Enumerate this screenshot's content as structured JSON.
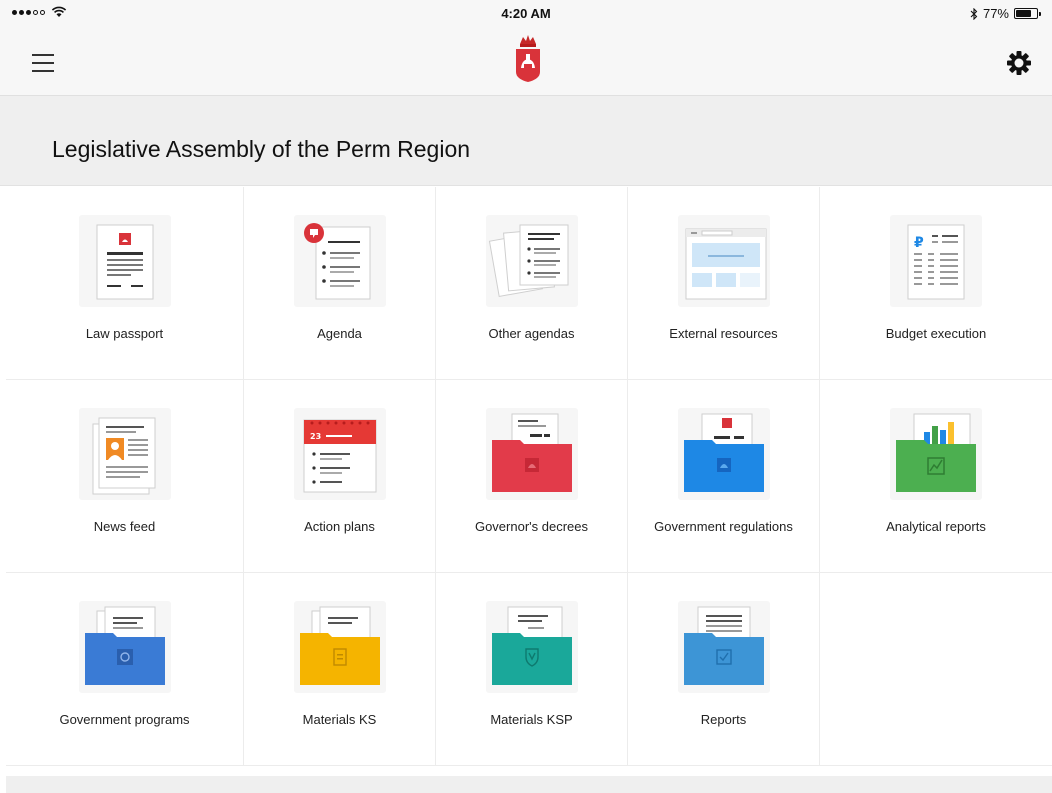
{
  "status_bar": {
    "time": "4:20 AM",
    "battery": "77%",
    "battery_level": 0.77
  },
  "header": {
    "title": "Legislative Assembly of the Perm Region"
  },
  "colors": {
    "crest_red": "#d9333a",
    "folder_red": "#e23b4a",
    "folder_blue": "#1e88e5",
    "folder_green": "#4caf50",
    "folder_gov_blue": "#3a7bd5",
    "folder_yellow": "#f5b400",
    "folder_teal": "#1aa89a",
    "folder_sky": "#3d95d6"
  },
  "tiles": [
    {
      "label": "Law passport",
      "icon": "law-passport-icon"
    },
    {
      "label": "Agenda",
      "icon": "agenda-icon"
    },
    {
      "label": "Other agendas",
      "icon": "other-agendas-icon"
    },
    {
      "label": "External resources",
      "icon": "external-resources-icon"
    },
    {
      "label": "Budget execution",
      "icon": "budget-execution-icon"
    },
    {
      "label": "News feed",
      "icon": "news-feed-icon"
    },
    {
      "label": "Action plans",
      "icon": "action-plans-icon",
      "calendar_day": "23"
    },
    {
      "label": "Governor's decrees",
      "icon": "governors-decrees-folder-icon"
    },
    {
      "label": "Government regulations",
      "icon": "government-regulations-folder-icon"
    },
    {
      "label": "Analytical reports",
      "icon": "analytical-reports-folder-icon"
    },
    {
      "label": "Government programs",
      "icon": "government-programs-folder-icon"
    },
    {
      "label": "Materials KS",
      "icon": "materials-ks-folder-icon"
    },
    {
      "label": "Materials KSP",
      "icon": "materials-ksp-folder-icon"
    },
    {
      "label": "Reports",
      "icon": "reports-folder-icon"
    }
  ]
}
